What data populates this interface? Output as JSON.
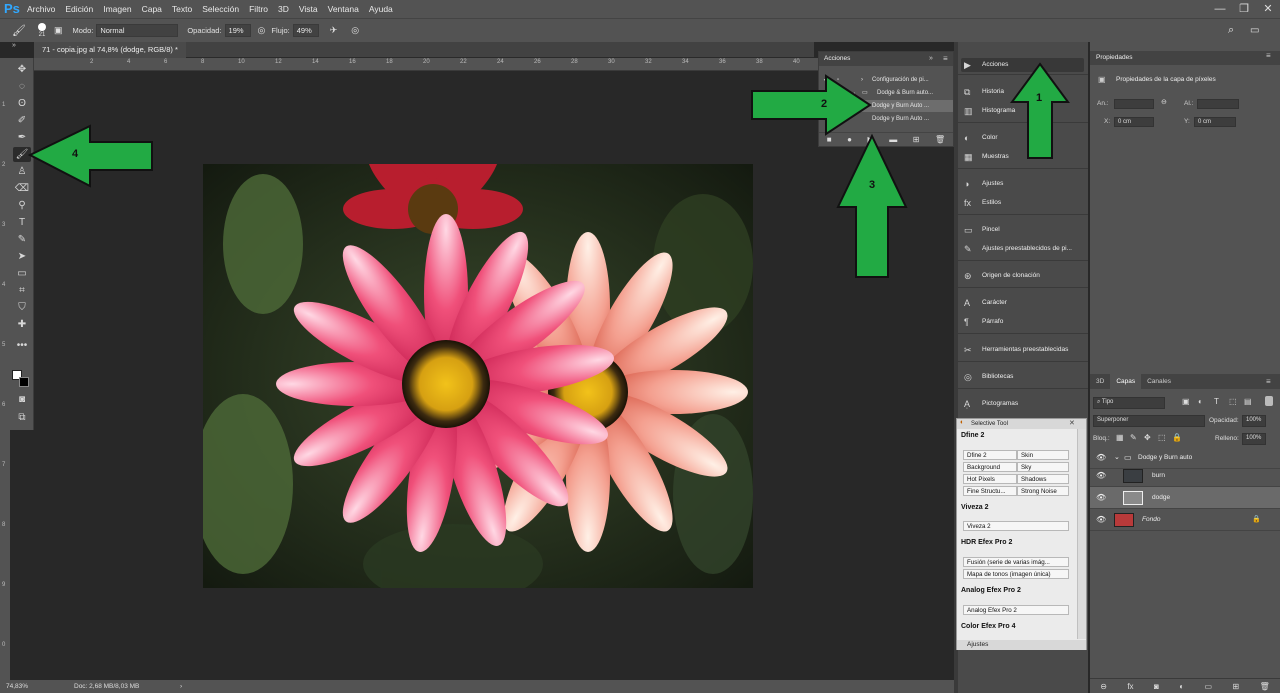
{
  "app": {
    "logo": "Ps"
  },
  "menu": [
    "Archivo",
    "Edición",
    "Imagen",
    "Capa",
    "Texto",
    "Selección",
    "Filtro",
    "3D",
    "Vista",
    "Ventana",
    "Ayuda"
  ],
  "window_controls": [
    "—",
    "❐",
    "✕"
  ],
  "options_bar": {
    "brush_size": "21",
    "mode_label": "Modo:",
    "mode_value": "Normal",
    "opacity_label": "Opacidad:",
    "opacity_value": "19%",
    "flow_label": "Flujo:",
    "flow_value": "49%"
  },
  "document_tab": "71 - copia.jpg al 74,8% (dodge, RGB/8) *",
  "ruler_numbers": [
    "2",
    "4",
    "6",
    "8",
    "10",
    "12",
    "14",
    "16",
    "18",
    "20",
    "22",
    "24",
    "26",
    "28",
    "30",
    "32",
    "34",
    "36",
    "38",
    "40",
    "10"
  ],
  "left_ruler_numbers": [
    "1",
    "2",
    "3",
    "4",
    "5",
    "6",
    "7",
    "8",
    "9",
    "0"
  ],
  "status": {
    "zoom": "74,83%",
    "doc": "Doc: 2,68 MB/8,03 MB"
  },
  "actions_panel": {
    "title": "Acciones",
    "rows": [
      "Configuración de pi...",
      "Dodge & Burn auto...",
      "Dodge y Burn Auto ...",
      "Dodge y Burn Auto ..."
    ]
  },
  "mid_panel": {
    "items": [
      {
        "label": "Acciones",
        "icon": "▶"
      },
      {
        "label": "Historia",
        "icon": "⧉"
      },
      {
        "label": "Histograma",
        "icon": "▥"
      },
      {
        "label": "Color",
        "icon": "◐"
      },
      {
        "label": "Muestras",
        "icon": "▦"
      },
      {
        "label": "Ajustes",
        "icon": "◑"
      },
      {
        "label": "Estilos",
        "icon": "fx"
      },
      {
        "label": "Pincel",
        "icon": "▭"
      },
      {
        "label": "Ajustes preestablecidos de pi...",
        "icon": "✎"
      },
      {
        "label": "Origen de clonación",
        "icon": "⊛"
      },
      {
        "label": "Carácter",
        "icon": "A"
      },
      {
        "label": "Párrafo",
        "icon": "¶"
      },
      {
        "label": "Herramientas preestablecidas",
        "icon": "✂"
      },
      {
        "label": "Bibliotecas",
        "icon": "◎"
      },
      {
        "label": "Pictogramas",
        "icon": "Ạ"
      }
    ]
  },
  "selective_tool": {
    "title": "Selective Tool",
    "sections": [
      {
        "name": "Dfine 2",
        "buttons": [
          "Dfine 2",
          "Skin",
          "Background",
          "Sky",
          "Hot Pixels",
          "Shadows",
          "Fine Structu...",
          "Strong Noise"
        ]
      },
      {
        "name": "Viveza 2",
        "buttons": [
          "Viveza 2"
        ]
      },
      {
        "name": "HDR Efex Pro 2",
        "buttons": [
          "Fusión (serie de varias imág...",
          "Mapa de tonos (imagen única)"
        ]
      },
      {
        "name": "Analog Efex Pro 2",
        "buttons": [
          "Analog Efex Pro 2"
        ]
      },
      {
        "name": "Color Efex Pro 4",
        "buttons": []
      }
    ],
    "footer": "Ajustes"
  },
  "properties": {
    "tab": "Propiedades",
    "title": "Propiedades de la capa de píxeles",
    "an_label": "An.:",
    "al_label": "Al.:",
    "x_label": "X:",
    "x_value": "0 cm",
    "y_label": "Y:",
    "y_value": "0 cm"
  },
  "layers": {
    "tabs": [
      "3D",
      "Capas",
      "Canales"
    ],
    "filter": "Tipo",
    "blend_mode": "Superponer",
    "opacity_label": "Opacidad:",
    "opacity_value": "100%",
    "lock_label": "Bloq.:",
    "fill_label": "Relleno:",
    "fill_value": "100%",
    "rows": [
      {
        "name": "Dodge y Burn auto"
      },
      {
        "name": "burn"
      },
      {
        "name": "dodge"
      },
      {
        "name": "Fondo"
      }
    ]
  },
  "callouts": [
    "1",
    "2",
    "3",
    "4"
  ],
  "colors": {
    "arrow": "#22aa44",
    "accent": "#31a8ff"
  }
}
